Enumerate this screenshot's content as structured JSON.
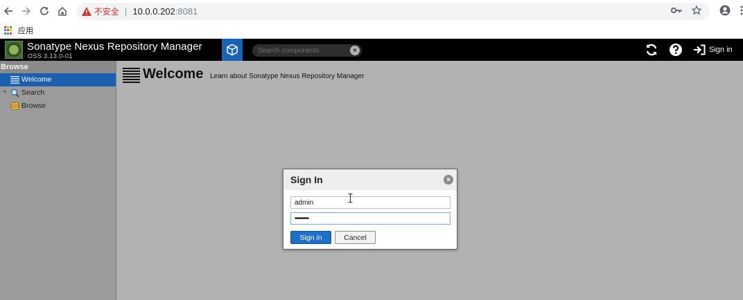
{
  "browser": {
    "insecure_label": "不安全",
    "url_separator": "|",
    "url_host": "10.0.0.202",
    "url_port": ":8081",
    "bookmarks_apps_label": "应用",
    "icons": [
      "back-arrow-icon",
      "forward-arrow-icon",
      "reload-icon",
      "home-icon",
      "warning-icon",
      "key-icon",
      "star-icon",
      "profile-icon",
      "menu-dots-icon",
      "apps-grid-icon"
    ]
  },
  "header": {
    "title": "Sonatype Nexus Repository Manager",
    "version": "OSS 3.13.0-01",
    "search_placeholder": "Search components",
    "signin_label": "Sign in",
    "accent_color": "#1a64b6"
  },
  "sidebar": {
    "title": "Browse",
    "items": [
      {
        "label": "Welcome",
        "selected": true,
        "icon": "welcome-list-icon"
      },
      {
        "label": "Search",
        "selected": false,
        "expandable": true,
        "icon": "magnifier-icon"
      },
      {
        "label": "Browse",
        "selected": false,
        "icon": "database-icon"
      }
    ]
  },
  "main": {
    "title": "Welcome",
    "subtitle": "Learn about Sonatype Nexus Repository Manager"
  },
  "dialog": {
    "title": "Sign In",
    "username_value": "admin",
    "password_value": "••••••••",
    "signin_button": "Sign in",
    "cancel_button": "Cancel"
  }
}
